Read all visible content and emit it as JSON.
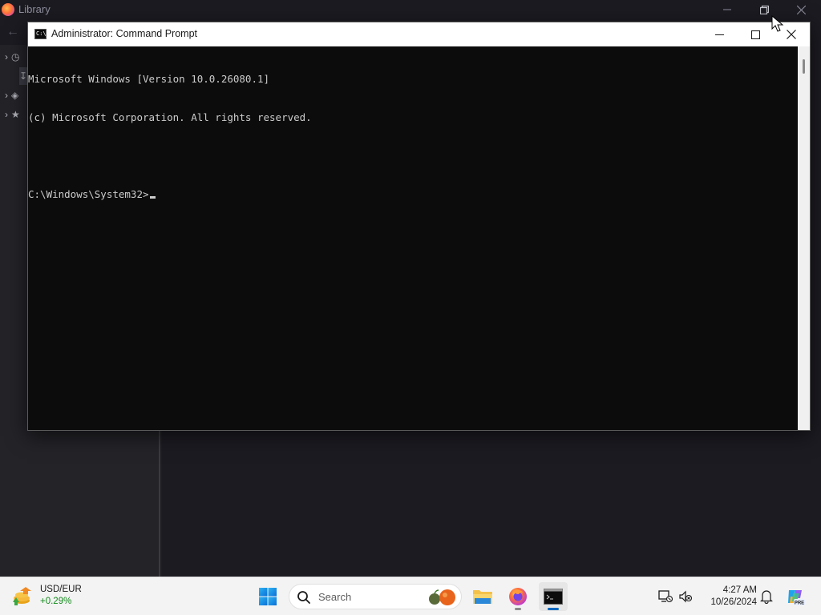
{
  "background_window": {
    "title": "Library",
    "controls": [
      "minimize",
      "restore",
      "close"
    ]
  },
  "cmd_window": {
    "title": "Administrator: Command Prompt",
    "lines": [
      "Microsoft Windows [Version 10.0.26080.1]",
      "(c) Microsoft Corporation. All rights reserved.",
      "",
      "C:\\Windows\\System32>"
    ]
  },
  "taskbar": {
    "widget": {
      "pair": "USD/EUR",
      "change": "+0.29%"
    },
    "search_placeholder": "Search",
    "apps": [
      {
        "name": "start",
        "icon": "windows-logo-icon"
      },
      {
        "name": "file-explorer",
        "icon": "folder-icon"
      },
      {
        "name": "firefox",
        "icon": "firefox-icon",
        "running": true
      },
      {
        "name": "command-prompt",
        "icon": "terminal-icon",
        "running": true,
        "active": true
      }
    ],
    "clock": {
      "time": "4:27 AM",
      "date": "10/26/2024"
    },
    "tray_icons": [
      "network-disconnected-icon",
      "volume-muted-icon",
      "notification-bell-icon",
      "copilot-icon"
    ],
    "copilot_badge": "PRE"
  },
  "colors": {
    "cmd_background": "#0c0c0c",
    "cmd_text": "#cccccc",
    "taskbar_background": "#f3f3f3",
    "accent": "#0067c0"
  }
}
